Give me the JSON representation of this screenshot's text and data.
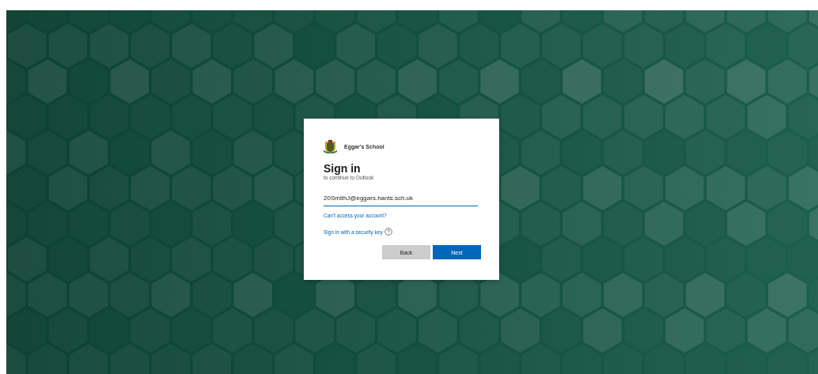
{
  "brand": {
    "name": "Eggar's School"
  },
  "heading": "Sign in",
  "subheading": "to continue to Outlook",
  "email_field": {
    "value": "20SmithJ@eggars.hants.sch.uk",
    "focused": true
  },
  "links": [
    {
      "label": "Can't access your account?",
      "kind": "plain"
    },
    {
      "label": "Sign in with a security key",
      "kind": "help"
    }
  ],
  "buttons": [
    {
      "label": "Back",
      "kind": "secondary"
    },
    {
      "label": "Next",
      "kind": "primary"
    }
  ]
}
